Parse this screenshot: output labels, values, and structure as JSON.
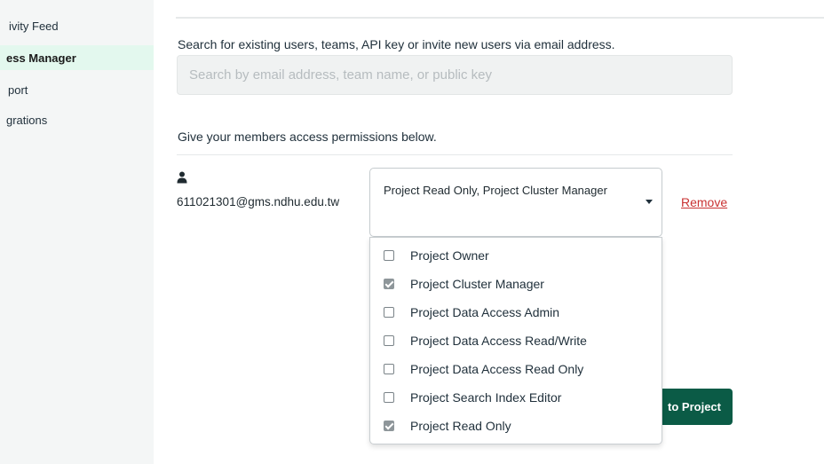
{
  "sidebar": {
    "items": [
      {
        "label": "ivity Feed",
        "active": false
      },
      {
        "label": "ess Manager",
        "active": true
      },
      {
        "label": "port",
        "active": false
      },
      {
        "label": "grations",
        "active": false
      }
    ]
  },
  "main": {
    "search_instruction": "Search for existing users, teams, API key or invite new users via email address.",
    "search_placeholder": "Search by email address, team name, or public key",
    "permissions_instruction": "Give your members access permissions below.",
    "member": {
      "email": "611021301@gms.ndhu.edu.tw",
      "selected_roles": "Project Read Only, Project Cluster Manager",
      "remove_label": "Remove",
      "user_icon": "user-icon"
    },
    "role_options": [
      {
        "label": "Project Owner",
        "checked": false
      },
      {
        "label": "Project Cluster Manager",
        "checked": true
      },
      {
        "label": "Project Data Access Admin",
        "checked": false
      },
      {
        "label": "Project Data Access Read/Write",
        "checked": false
      },
      {
        "label": "Project Data Access Read Only",
        "checked": false
      },
      {
        "label": "Project Search Index Editor",
        "checked": false
      },
      {
        "label": "Project Read Only",
        "checked": true
      }
    ],
    "add_button_label": "to Project"
  },
  "colors": {
    "active_nav_bg": "#e3f8ee",
    "primary_button": "#0b5b46",
    "remove_link": "#c93232"
  }
}
